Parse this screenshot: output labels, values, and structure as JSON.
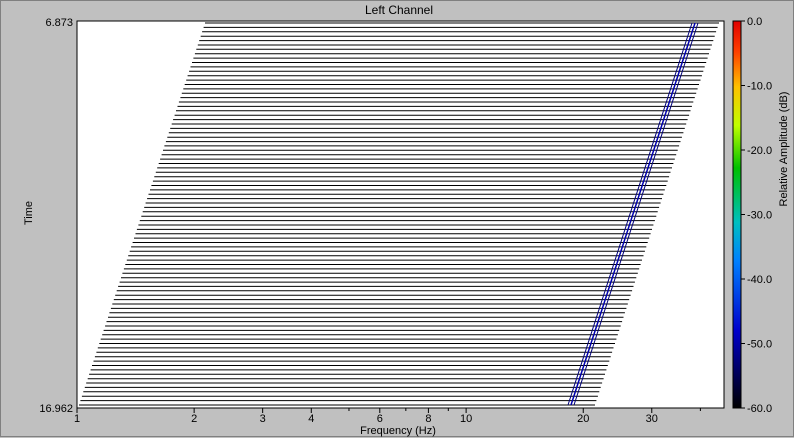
{
  "chart_data": {
    "type": "waterfall",
    "title": "Left Channel",
    "xlabel": "Frequency (Hz)",
    "ylabel": "Time",
    "x_scale": "log",
    "xlim": [
      1,
      46
    ],
    "x_ticks": [
      1,
      2,
      3,
      4,
      6,
      8,
      10,
      20,
      30
    ],
    "x_minor_ticks": [
      5,
      7,
      9,
      40
    ],
    "ylim": [
      6.873,
      16.962
    ],
    "y_tick_labels": [
      "6.873",
      "16.962"
    ],
    "trace_count": 88,
    "ridge": {
      "description_points_time": [
        6.873,
        16.962
      ],
      "description_points_freq_hz": [
        32.5,
        32.5
      ]
    },
    "colorbar": {
      "label": "Relative Amplitude (dB)",
      "range": [
        -60,
        0
      ],
      "ticks": [
        "0.0",
        "-10.0",
        "-20.0",
        "-30.0",
        "-40.0",
        "-50.0",
        "-60.0"
      ],
      "colors": [
        "#000000",
        "#0000cc",
        "#0080ff",
        "#00c0c0",
        "#00c000",
        "#c0ff00",
        "#ffc000",
        "#ff4000",
        "#e00000"
      ]
    },
    "colors": {
      "trace": "#000000",
      "ridge": "#00007a",
      "background": "#c0c0c0",
      "plot": "#ffffff"
    }
  }
}
